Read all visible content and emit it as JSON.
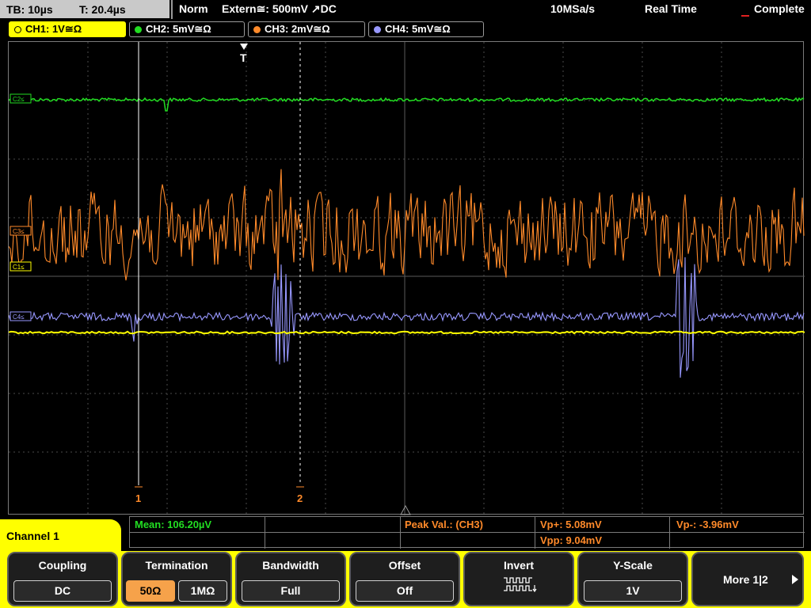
{
  "topbar": {
    "tb": "TB: 10µs",
    "t": "T: 20.4µs",
    "mode": "Norm",
    "trigger": "Extern≅: 500mV ↗DC",
    "sample_rate": "10MSa/s",
    "acq_mode": "Real Time",
    "status": "Complete"
  },
  "channels": [
    {
      "label": "CH1: 1V≅Ω",
      "color": "#ffff00"
    },
    {
      "label": "CH2: 5mV≅Ω",
      "color": "#22dd22"
    },
    {
      "label": "CH3: 2mV≅Ω",
      "color": "#ff8a2a"
    },
    {
      "label": "CH4: 5mV≅Ω",
      "color": "#9898ff"
    }
  ],
  "waveform_labels": {
    "ch2": "C2≤",
    "ch3": "C3≤",
    "ch1": "C1≤",
    "ch4": "C4≤",
    "trigger": "T",
    "cursor1": "1",
    "cursor2": "2"
  },
  "measurement": {
    "mean": "Mean: 106.20µV",
    "peak_label": "Peak Val.: (CH3)",
    "vp_plus": "Vp+: 5.08mV",
    "vp_minus": "Vp-: -3.96mV",
    "vpp": "Vpp: 9.04mV"
  },
  "menu": {
    "title": "Channel 1",
    "coupling": {
      "title": "Coupling",
      "value": "DC"
    },
    "termination": {
      "title": "Termination",
      "opt1": "50Ω",
      "opt2": "1MΩ"
    },
    "bandwidth": {
      "title": "Bandwidth",
      "value": "Full"
    },
    "offset": {
      "title": "Offset",
      "value": "Off"
    },
    "invert": {
      "title": "Invert"
    },
    "yscale": {
      "title": "Y-Scale",
      "value": "1V"
    },
    "more": {
      "label": "More 1|2"
    }
  },
  "colors": {
    "ch1": "#ffff00",
    "ch2": "#22dd22",
    "ch3": "#ff8a2a",
    "ch4": "#9898ff",
    "grid": "#555555"
  }
}
